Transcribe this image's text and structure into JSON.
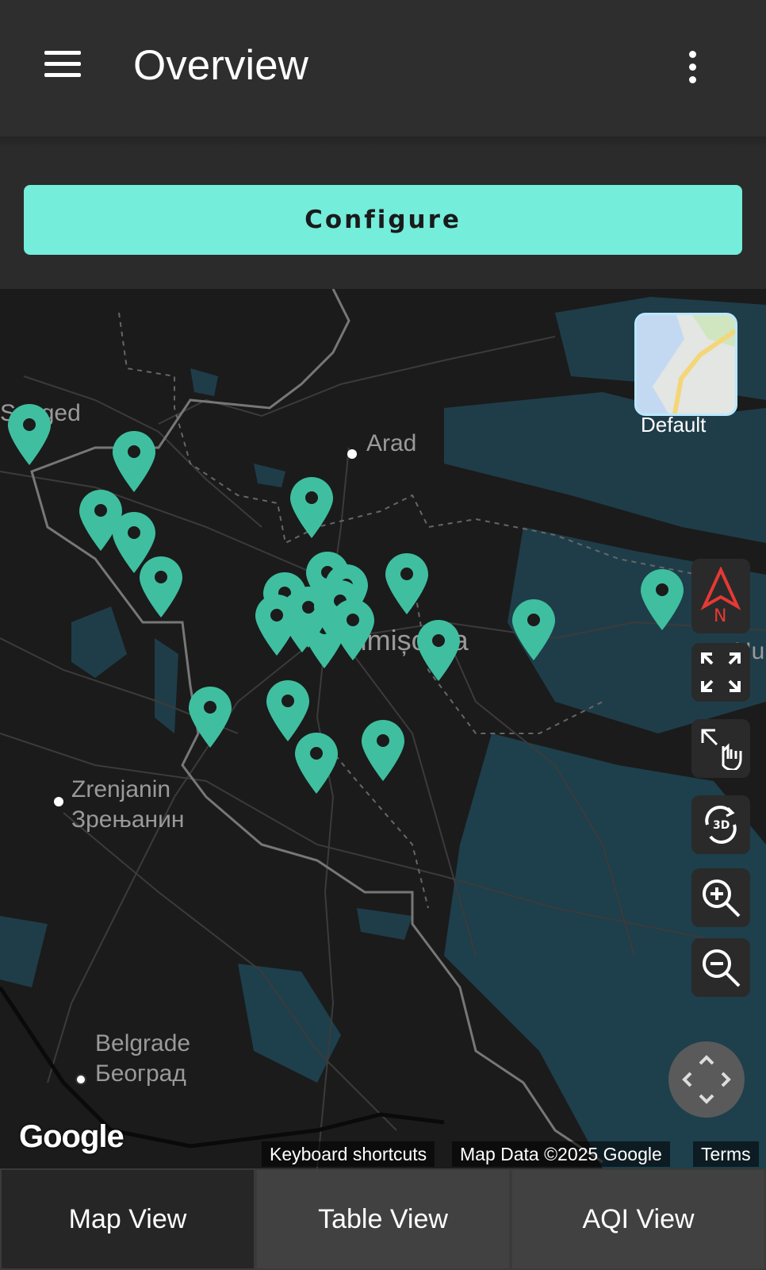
{
  "app_bar": {
    "title": "Overview",
    "menu_icon": "menu-icon",
    "more_icon": "more-vert-icon"
  },
  "configure_button": {
    "label": "Configure",
    "color": "#74eddb"
  },
  "map": {
    "place_labels": [
      "Szeged",
      "Arad",
      "Timișoara",
      "Zrenjanin",
      "Зрењанин",
      "Belgrade",
      "Београд",
      "Hu"
    ],
    "layer_button": {
      "label": "Default"
    },
    "controls": [
      "compass-icon",
      "fullscreen-icon",
      "gesture-icon",
      "rotate-3d-icon",
      "zoom-in-icon",
      "zoom-out-icon"
    ],
    "compass_label": "N",
    "pin_color": "#3fbfa0",
    "pin_count": 24,
    "attribution": {
      "logo": "Google",
      "shortcuts": "Keyboard shortcuts",
      "data": "Map Data ©2025 Google",
      "terms": "Terms"
    }
  },
  "bottom_nav": {
    "tabs": [
      {
        "label": "Map View"
      },
      {
        "label": "Table View"
      },
      {
        "label": "AQI View"
      }
    ]
  }
}
